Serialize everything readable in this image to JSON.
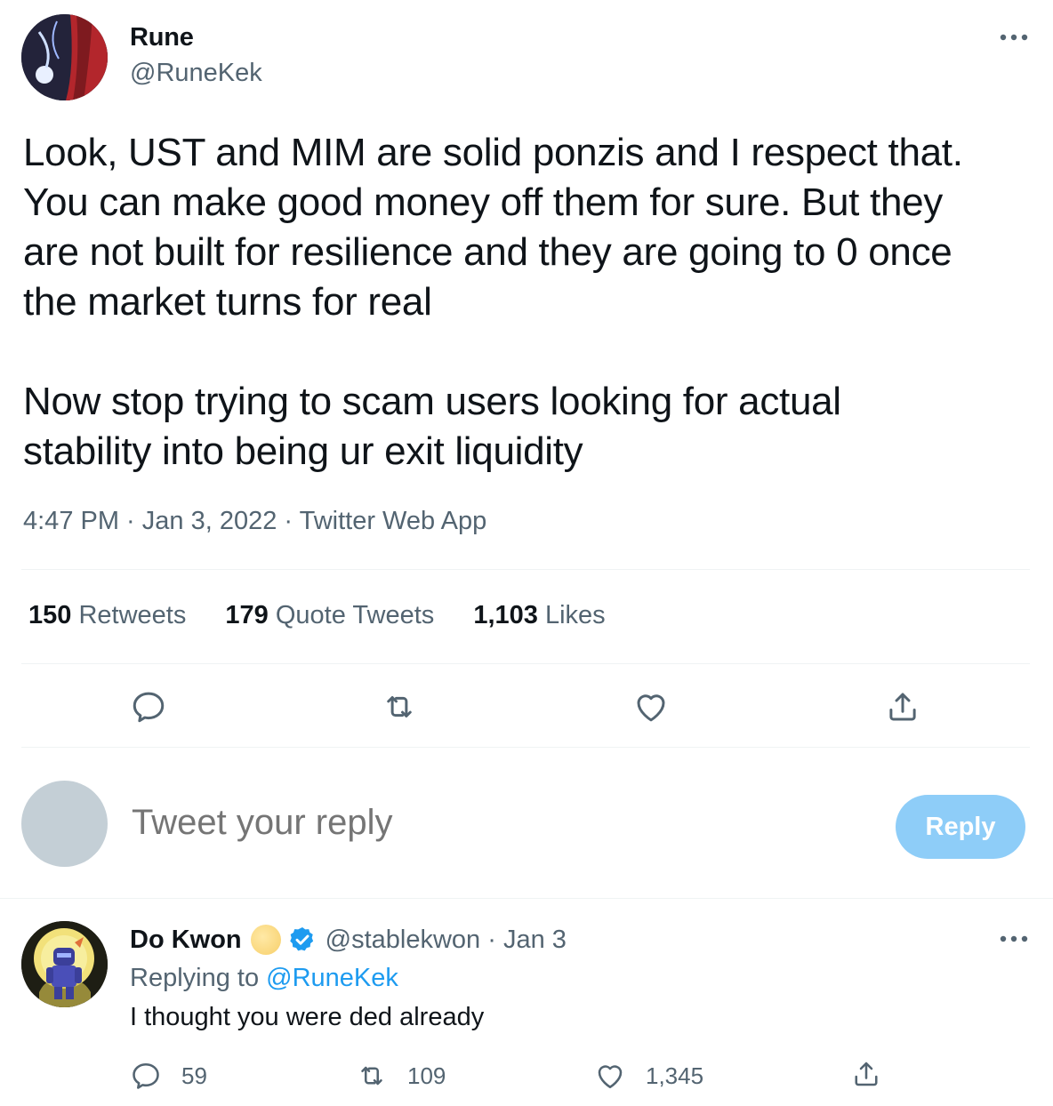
{
  "main_tweet": {
    "author_name": "Rune",
    "author_handle": "@RuneKek",
    "text_lines_p1": [
      "Look, UST and MIM are solid ponzis and I respect that.",
      "You can make good money off them for sure. But they",
      "are not built for resilience and they are going to 0 once",
      "the market turns for real"
    ],
    "text_lines_p2": [
      "Now stop trying to scam users looking for actual",
      "stability into being ur exit liquidity"
    ],
    "meta": "4:47 PM · Jan 3, 2022 · Twitter Web App",
    "stats": {
      "retweets_count": "150",
      "retweets_label": "Retweets",
      "quotes_count": "179",
      "quotes_label": "Quote Tweets",
      "likes_count": "1,103",
      "likes_label": "Likes"
    },
    "actions": [
      "reply-icon",
      "retweet-icon",
      "like-icon",
      "share-icon"
    ]
  },
  "composer": {
    "placeholder": "Tweet your reply",
    "button_label": "Reply"
  },
  "reply_tweet": {
    "author_name": "Do Kwon",
    "author_handle": "@stablekwon · Jan 3",
    "replying_prefix": "Replying to",
    "replying_mention": "@RuneKek",
    "text": "I thought you were ded already",
    "reply_count": "59",
    "retweet_count": "109",
    "like_count": "1,345"
  },
  "colors": {
    "text_primary": "#0f1419",
    "text_secondary": "#536471",
    "accent": "#1d9bf0",
    "reply_button_disabled": "#8ecdf8",
    "divider": "#eff3f4"
  }
}
